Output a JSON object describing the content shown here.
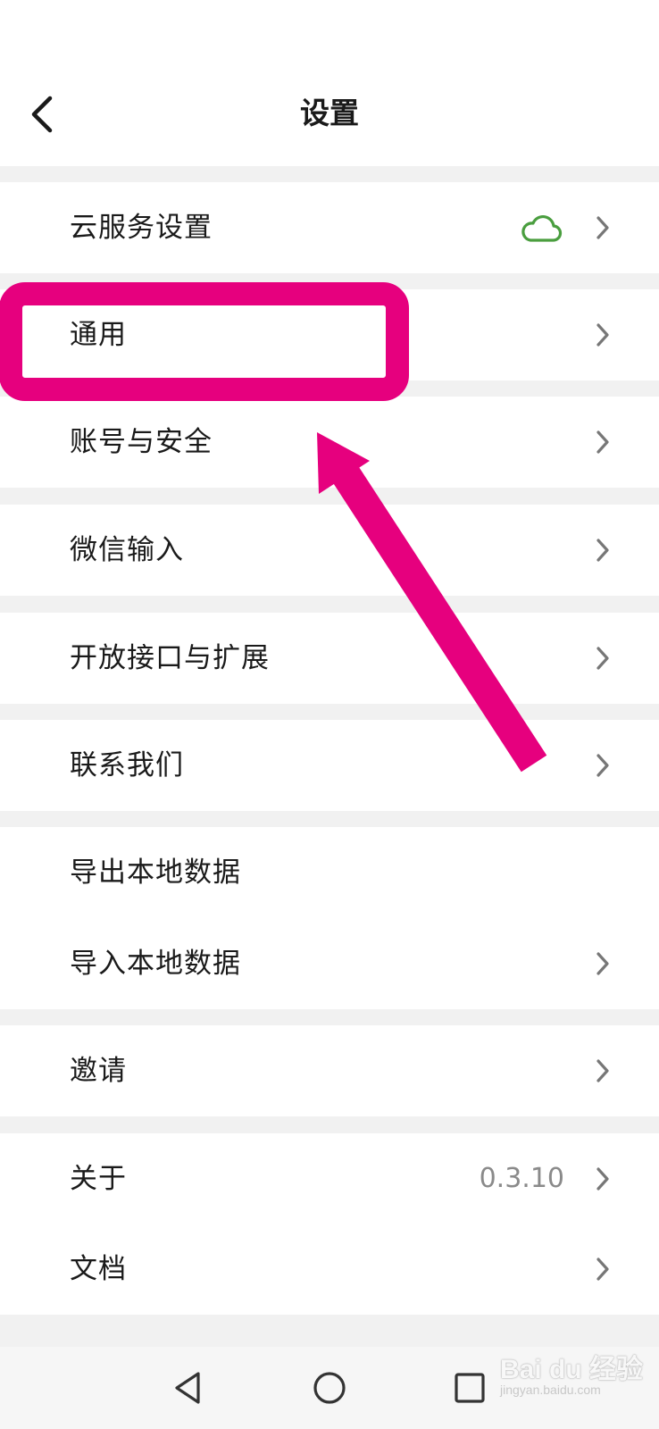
{
  "header": {
    "title": "设置"
  },
  "rows": {
    "cloud": {
      "label": "云服务设置"
    },
    "general": {
      "label": "通用"
    },
    "account": {
      "label": "账号与安全"
    },
    "wechat_input": {
      "label": "微信输入"
    },
    "open_api": {
      "label": "开放接口与扩展"
    },
    "contact": {
      "label": "联系我们"
    },
    "export": {
      "label": "导出本地数据"
    },
    "import": {
      "label": "导入本地数据"
    },
    "invite": {
      "label": "邀请"
    },
    "about": {
      "label": "关于",
      "value": "0.3.10"
    },
    "docs": {
      "label": "文档"
    }
  },
  "icons": {
    "back": "chevron-left-icon",
    "chevron": "chevron-right-icon",
    "cloud": "cloud-icon",
    "nav_back": "triangle-back-icon",
    "nav_home": "circle-home-icon",
    "nav_recents": "square-recents-icon"
  },
  "colors": {
    "cloud_icon": "#4a9e3f",
    "annotation": "#e6007e"
  },
  "watermark": {
    "text": "Bai du 经验",
    "sub": "jingyan.baidu.com"
  }
}
